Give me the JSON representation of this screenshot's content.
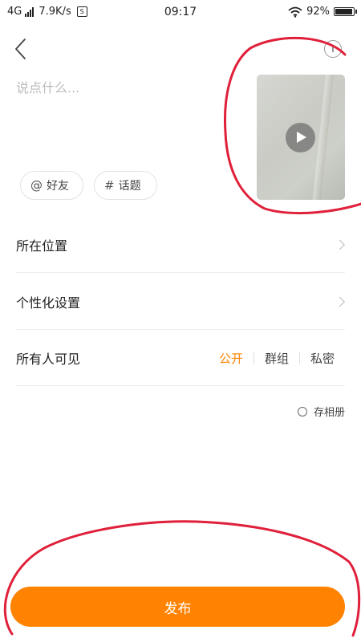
{
  "status_bar": {
    "network": "4G",
    "speed": "7.9K/s",
    "sim_icon": "sim-icon",
    "time": "09:17",
    "battery": "92%"
  },
  "composer": {
    "placeholder": "说点什么...",
    "mention_label": "好友",
    "topic_label": "话题",
    "mention_icon": "@",
    "topic_icon": "#"
  },
  "settings": {
    "location_label": "所在位置",
    "personalize_label": "个性化设置",
    "visibility_label": "所有人可见",
    "visibility_options": [
      "公开",
      "群组",
      "私密"
    ],
    "selected_visibility": "公开"
  },
  "save_album_label": "存相册",
  "publish_label": "发布",
  "colors": {
    "accent": "#ff8200",
    "annotation": "#e0203a"
  }
}
